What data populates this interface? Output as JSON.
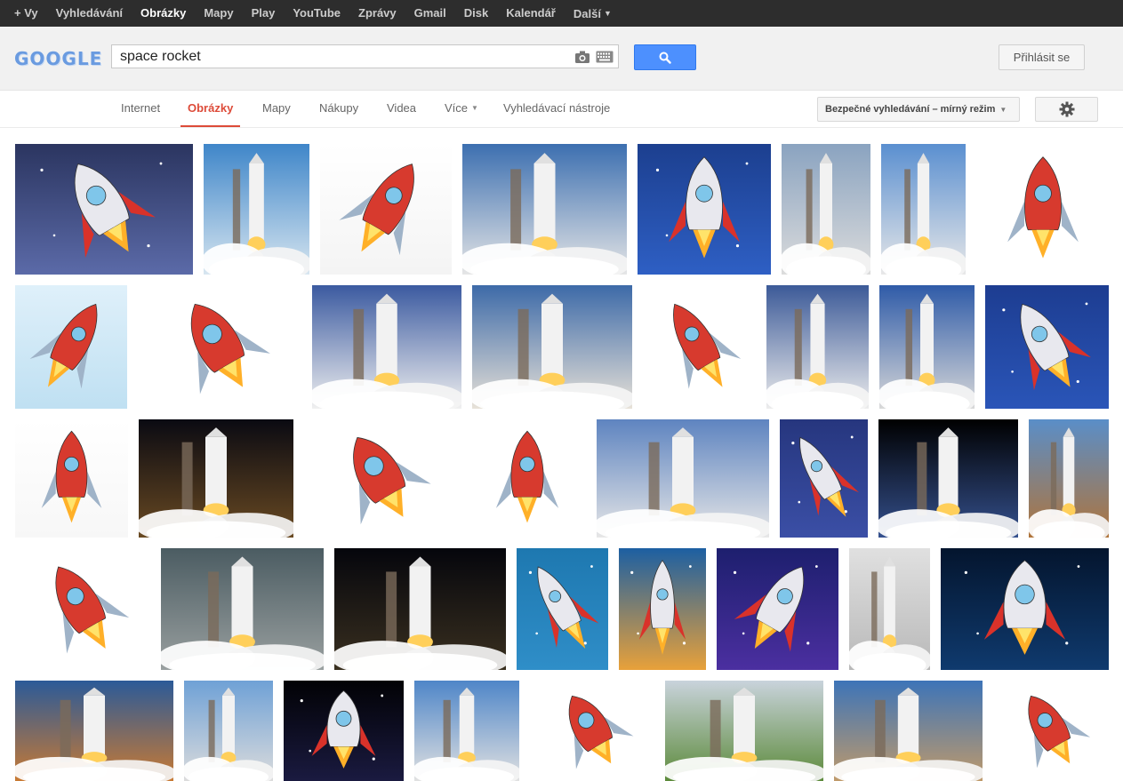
{
  "topbar": {
    "items": [
      "+ Vy",
      "Vyhledávání",
      "Obrázky",
      "Mapy",
      "Play",
      "YouTube",
      "Zprávy",
      "Gmail",
      "Disk",
      "Kalendář",
      "Další"
    ],
    "active_index": 2
  },
  "header": {
    "logo_text": "GOOGLE",
    "search_value": "space rocket",
    "signin_label": "Přihlásit se"
  },
  "tabs": {
    "items": [
      "Internet",
      "Obrázky",
      "Mapy",
      "Nákupy",
      "Videa",
      "Více",
      "Vyhledávací nástroje"
    ],
    "active_index": 1,
    "safe_search_label": "Bezpečné vyhledávání – mírný režim"
  },
  "colors": {
    "topbar_bg": "#2d2d2d",
    "accent_red": "#dd4b39",
    "search_blue": "#4d90fe",
    "header_bg": "#f1f1f1"
  },
  "icons": {
    "camera": "camera-icon",
    "keyboard": "keyboard-icon",
    "search": "search-icon",
    "gear": "gear-icon",
    "caret": "chevron-down-icon"
  },
  "results": {
    "image_count": 41
  }
}
